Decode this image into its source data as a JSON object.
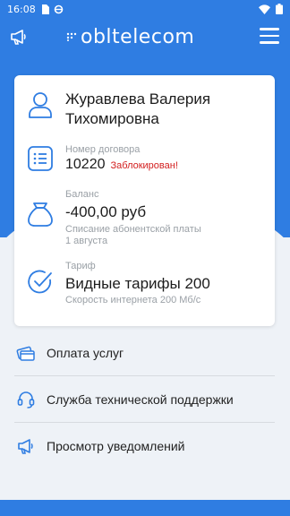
{
  "status_bar": {
    "time": "16:08",
    "icons": [
      "sim-icon",
      "ring-icon",
      "wifi-icon",
      "battery-icon"
    ]
  },
  "header": {
    "brand": "obltelecom",
    "icons": {
      "left": "megaphone-icon",
      "right": "hamburger-menu-icon"
    }
  },
  "colors": {
    "primary": "#2f7de2",
    "background": "#eef2f7",
    "alert": "#d32020",
    "muted": "#9aa0a6"
  },
  "account": {
    "name_line1": "Журавлева Валерия",
    "name_line2": "Тихомировна",
    "contract_label": "Номер договора",
    "contract_number": "10220",
    "contract_status": "Заблокирован!",
    "balance_label": "Баланс",
    "balance_value": "-400,00 руб",
    "balance_note_line1": "Списание абонентской платы",
    "balance_note_line2": "1 августа",
    "tariff_label": "Тариф",
    "tariff_name": "Видные тарифы 200",
    "tariff_speed": "Скорость интернета 200 Мб/с"
  },
  "menu": {
    "payment": "Оплата услуг",
    "support": "Служба технической поддержки",
    "notifications": "Просмотр уведомлений"
  }
}
